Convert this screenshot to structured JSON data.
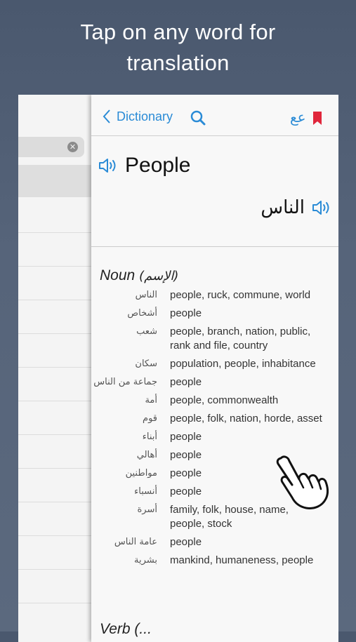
{
  "headline": {
    "line1": "Tap on any word for",
    "line2": "translation"
  },
  "navbar": {
    "back_label": "Dictionary",
    "arabic_toggle": "عع",
    "accent_color": "#2a8bd6",
    "bookmark_color": "#e0263b"
  },
  "word": {
    "english": "People",
    "arabic": "الناس"
  },
  "noun_section": {
    "title": "Noun",
    "title_ar": "(الإسم)"
  },
  "entries": [
    {
      "ar": "الناس",
      "en": "people, ruck, commune, world"
    },
    {
      "ar": "أشخاص",
      "en": "people"
    },
    {
      "ar": "شعب",
      "en": "people, branch, nation, public, rank and file, country"
    },
    {
      "ar": "سكان",
      "en": "population, people, inhabitance"
    },
    {
      "ar": "جماعة من الناس",
      "en": "people"
    },
    {
      "ar": "أمة",
      "en": "people, commonwealth"
    },
    {
      "ar": "قوم",
      "en": "people, folk, nation, horde, asset"
    },
    {
      "ar": "أبناء",
      "en": "people"
    },
    {
      "ar": "أهالي",
      "en": "people"
    },
    {
      "ar": "مواطنين",
      "en": "people"
    },
    {
      "ar": "أنسباء",
      "en": "people"
    },
    {
      "ar": "أسرة",
      "en": "family, folk, house, name, people, stock"
    },
    {
      "ar": "عامة الناس",
      "en": "people"
    },
    {
      "ar": "بشرية",
      "en": "mankind, humaneness, people"
    }
  ],
  "verb_section": {
    "title": "Verb (..."
  }
}
